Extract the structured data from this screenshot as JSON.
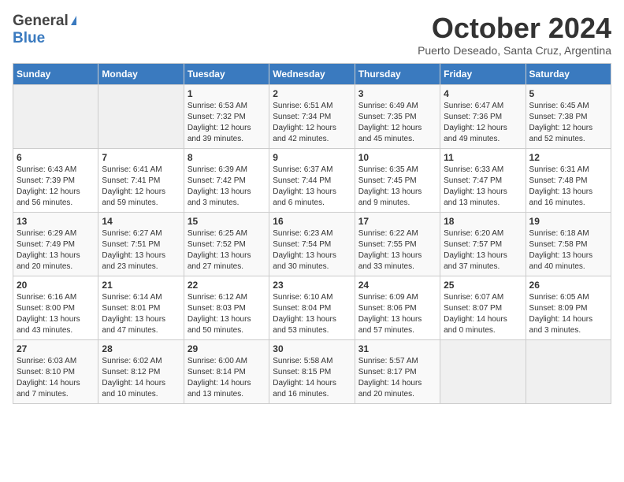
{
  "header": {
    "logo_general": "General",
    "logo_blue": "Blue",
    "month_title": "October 2024",
    "location": "Puerto Deseado, Santa Cruz, Argentina"
  },
  "weekdays": [
    "Sunday",
    "Monday",
    "Tuesday",
    "Wednesday",
    "Thursday",
    "Friday",
    "Saturday"
  ],
  "weeks": [
    [
      {
        "day": "",
        "lines": []
      },
      {
        "day": "",
        "lines": []
      },
      {
        "day": "1",
        "lines": [
          "Sunrise: 6:53 AM",
          "Sunset: 7:32 PM",
          "Daylight: 12 hours",
          "and 39 minutes."
        ]
      },
      {
        "day": "2",
        "lines": [
          "Sunrise: 6:51 AM",
          "Sunset: 7:34 PM",
          "Daylight: 12 hours",
          "and 42 minutes."
        ]
      },
      {
        "day": "3",
        "lines": [
          "Sunrise: 6:49 AM",
          "Sunset: 7:35 PM",
          "Daylight: 12 hours",
          "and 45 minutes."
        ]
      },
      {
        "day": "4",
        "lines": [
          "Sunrise: 6:47 AM",
          "Sunset: 7:36 PM",
          "Daylight: 12 hours",
          "and 49 minutes."
        ]
      },
      {
        "day": "5",
        "lines": [
          "Sunrise: 6:45 AM",
          "Sunset: 7:38 PM",
          "Daylight: 12 hours",
          "and 52 minutes."
        ]
      }
    ],
    [
      {
        "day": "6",
        "lines": [
          "Sunrise: 6:43 AM",
          "Sunset: 7:39 PM",
          "Daylight: 12 hours",
          "and 56 minutes."
        ]
      },
      {
        "day": "7",
        "lines": [
          "Sunrise: 6:41 AM",
          "Sunset: 7:41 PM",
          "Daylight: 12 hours",
          "and 59 minutes."
        ]
      },
      {
        "day": "8",
        "lines": [
          "Sunrise: 6:39 AM",
          "Sunset: 7:42 PM",
          "Daylight: 13 hours",
          "and 3 minutes."
        ]
      },
      {
        "day": "9",
        "lines": [
          "Sunrise: 6:37 AM",
          "Sunset: 7:44 PM",
          "Daylight: 13 hours",
          "and 6 minutes."
        ]
      },
      {
        "day": "10",
        "lines": [
          "Sunrise: 6:35 AM",
          "Sunset: 7:45 PM",
          "Daylight: 13 hours",
          "and 9 minutes."
        ]
      },
      {
        "day": "11",
        "lines": [
          "Sunrise: 6:33 AM",
          "Sunset: 7:47 PM",
          "Daylight: 13 hours",
          "and 13 minutes."
        ]
      },
      {
        "day": "12",
        "lines": [
          "Sunrise: 6:31 AM",
          "Sunset: 7:48 PM",
          "Daylight: 13 hours",
          "and 16 minutes."
        ]
      }
    ],
    [
      {
        "day": "13",
        "lines": [
          "Sunrise: 6:29 AM",
          "Sunset: 7:49 PM",
          "Daylight: 13 hours",
          "and 20 minutes."
        ]
      },
      {
        "day": "14",
        "lines": [
          "Sunrise: 6:27 AM",
          "Sunset: 7:51 PM",
          "Daylight: 13 hours",
          "and 23 minutes."
        ]
      },
      {
        "day": "15",
        "lines": [
          "Sunrise: 6:25 AM",
          "Sunset: 7:52 PM",
          "Daylight: 13 hours",
          "and 27 minutes."
        ]
      },
      {
        "day": "16",
        "lines": [
          "Sunrise: 6:23 AM",
          "Sunset: 7:54 PM",
          "Daylight: 13 hours",
          "and 30 minutes."
        ]
      },
      {
        "day": "17",
        "lines": [
          "Sunrise: 6:22 AM",
          "Sunset: 7:55 PM",
          "Daylight: 13 hours",
          "and 33 minutes."
        ]
      },
      {
        "day": "18",
        "lines": [
          "Sunrise: 6:20 AM",
          "Sunset: 7:57 PM",
          "Daylight: 13 hours",
          "and 37 minutes."
        ]
      },
      {
        "day": "19",
        "lines": [
          "Sunrise: 6:18 AM",
          "Sunset: 7:58 PM",
          "Daylight: 13 hours",
          "and 40 minutes."
        ]
      }
    ],
    [
      {
        "day": "20",
        "lines": [
          "Sunrise: 6:16 AM",
          "Sunset: 8:00 PM",
          "Daylight: 13 hours",
          "and 43 minutes."
        ]
      },
      {
        "day": "21",
        "lines": [
          "Sunrise: 6:14 AM",
          "Sunset: 8:01 PM",
          "Daylight: 13 hours",
          "and 47 minutes."
        ]
      },
      {
        "day": "22",
        "lines": [
          "Sunrise: 6:12 AM",
          "Sunset: 8:03 PM",
          "Daylight: 13 hours",
          "and 50 minutes."
        ]
      },
      {
        "day": "23",
        "lines": [
          "Sunrise: 6:10 AM",
          "Sunset: 8:04 PM",
          "Daylight: 13 hours",
          "and 53 minutes."
        ]
      },
      {
        "day": "24",
        "lines": [
          "Sunrise: 6:09 AM",
          "Sunset: 8:06 PM",
          "Daylight: 13 hours",
          "and 57 minutes."
        ]
      },
      {
        "day": "25",
        "lines": [
          "Sunrise: 6:07 AM",
          "Sunset: 8:07 PM",
          "Daylight: 14 hours",
          "and 0 minutes."
        ]
      },
      {
        "day": "26",
        "lines": [
          "Sunrise: 6:05 AM",
          "Sunset: 8:09 PM",
          "Daylight: 14 hours",
          "and 3 minutes."
        ]
      }
    ],
    [
      {
        "day": "27",
        "lines": [
          "Sunrise: 6:03 AM",
          "Sunset: 8:10 PM",
          "Daylight: 14 hours",
          "and 7 minutes."
        ]
      },
      {
        "day": "28",
        "lines": [
          "Sunrise: 6:02 AM",
          "Sunset: 8:12 PM",
          "Daylight: 14 hours",
          "and 10 minutes."
        ]
      },
      {
        "day": "29",
        "lines": [
          "Sunrise: 6:00 AM",
          "Sunset: 8:14 PM",
          "Daylight: 14 hours",
          "and 13 minutes."
        ]
      },
      {
        "day": "30",
        "lines": [
          "Sunrise: 5:58 AM",
          "Sunset: 8:15 PM",
          "Daylight: 14 hours",
          "and 16 minutes."
        ]
      },
      {
        "day": "31",
        "lines": [
          "Sunrise: 5:57 AM",
          "Sunset: 8:17 PM",
          "Daylight: 14 hours",
          "and 20 minutes."
        ]
      },
      {
        "day": "",
        "lines": []
      },
      {
        "day": "",
        "lines": []
      }
    ]
  ]
}
